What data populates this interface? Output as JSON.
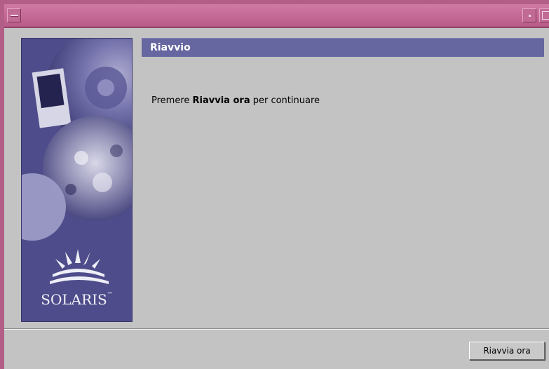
{
  "window": {
    "frame_color": "#b25e86",
    "menu_icon": "window-menu-icon",
    "minimize_icon": "minimize-icon",
    "maximize_icon": "maximize-icon"
  },
  "side_panel": {
    "brand": "SOLARIS",
    "trademark": "™",
    "logo_icon": "solaris-sun-logo-icon"
  },
  "header": {
    "title": "Riavvio",
    "color": "#6666a0"
  },
  "message": {
    "prefix": "Premere ",
    "emphasis": "Riavvia ora",
    "suffix": " per continuare"
  },
  "footer": {
    "restart_label": "Riavvia ora"
  }
}
